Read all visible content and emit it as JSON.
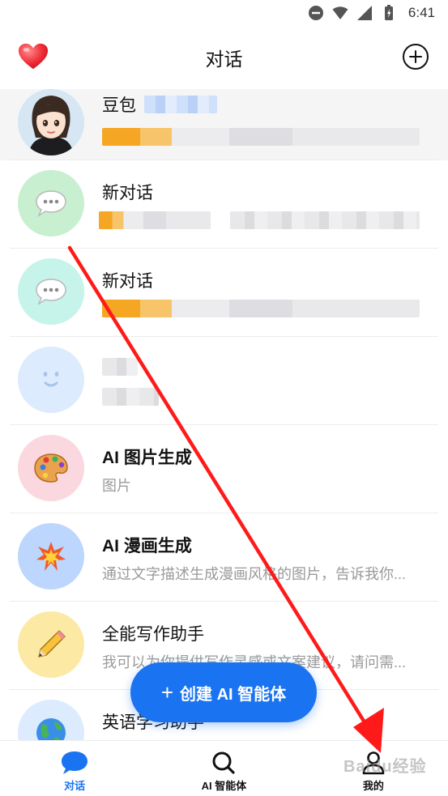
{
  "status_bar": {
    "time": "6:41"
  },
  "header": {
    "title": "对话"
  },
  "chats": [
    {
      "name": "豆包",
      "preview": "",
      "avatar": "avatar-doubao"
    },
    {
      "name": "新对话",
      "preview": "",
      "avatar": "chat-bubble-icon"
    },
    {
      "name": "新对话",
      "preview": "",
      "avatar": "chat-bubble-icon"
    },
    {
      "name": "",
      "preview": "",
      "avatar": "smiley-face-icon"
    },
    {
      "name": "AI 图片生成",
      "preview": "图片",
      "avatar": "palette-icon"
    },
    {
      "name": "AI 漫画生成",
      "preview": "通过文字描述生成漫画风格的图片，告诉我你...",
      "avatar": "explosion-icon"
    },
    {
      "name": "全能写作助手",
      "preview": "我可以为你提供写作灵感或文案建议，请问需...",
      "avatar": "pencil-icon"
    },
    {
      "name": "英语学习助手",
      "preview": "",
      "avatar": "globe-icon"
    }
  ],
  "create_button": {
    "label": "创建 AI 智能体",
    "plus": "+"
  },
  "bottom_nav": [
    {
      "label": "对话",
      "icon": "chat-bubble-icon",
      "active": true
    },
    {
      "label": "AI 智能体",
      "icon": "search-icon",
      "active": false
    },
    {
      "label": "我的",
      "icon": "user-icon",
      "active": false
    }
  ],
  "watermark": "Baidu经验",
  "colors": {
    "accent": "#1a73f0",
    "annotation_arrow": "#ff1a1a",
    "avatar_green": "#c8efd0",
    "avatar_mint": "#c6f3ea",
    "avatar_lightblue": "#dcebfd",
    "avatar_pink": "#fbd7df",
    "avatar_blue": "#bcd6fd",
    "avatar_yellow": "#fbe9a4"
  }
}
